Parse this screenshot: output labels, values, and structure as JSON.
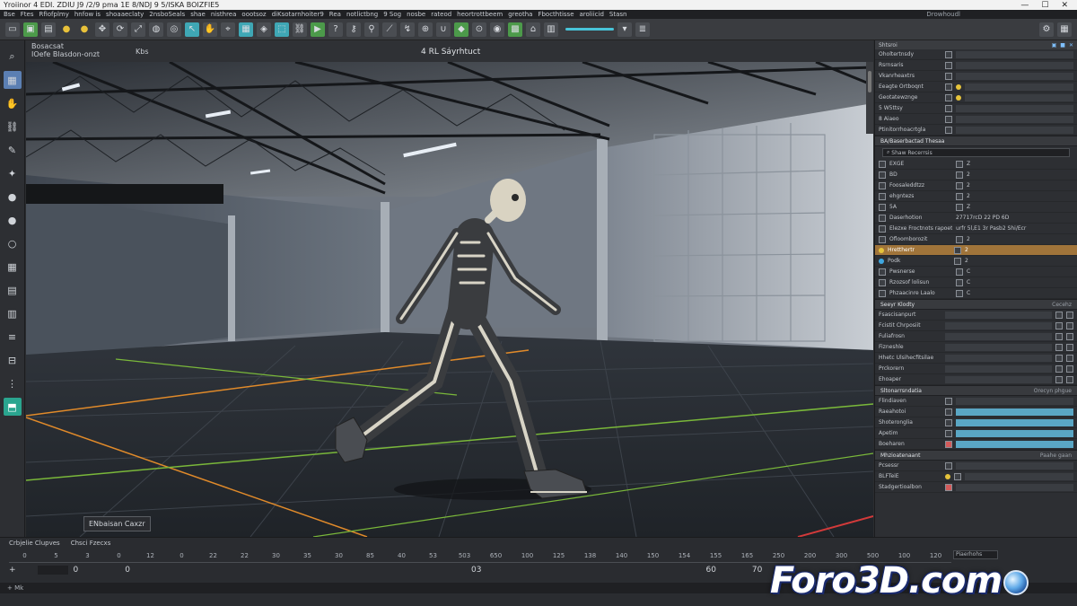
{
  "window": {
    "title": "Yroiinor 4 EDI. ZDIU J9 /2/9 pma 1E 8/NDJ 9 5/ISKA BOIZFIE5",
    "minimize": "—",
    "maximize": "☐",
    "close": "✕"
  },
  "menu": {
    "items": [
      "Bse",
      "Ftes",
      "Rfiofplmy",
      "hnfow is",
      "shoaaeclaty",
      "2nsboSeals",
      "shae",
      "nisthrea",
      "oootsoz",
      "diKsotarnhoiter9",
      "Rea",
      "notlictbng",
      "9 Sog",
      "nosbe",
      "rateod",
      "heortrottbeem",
      "greotha",
      "Fbocthtisse",
      "aroliicid",
      "Stasn"
    ],
    "right_label": "Drowhoudl"
  },
  "toolbar": {
    "right_icons": [
      "gear-icon",
      "grid-icon"
    ]
  },
  "viewport": {
    "panel_title": "Bosacsat",
    "panel_subtitle": "IOefe Blasdon-onzt",
    "mode_label": "Kbs",
    "camera_label": "4 RL Sáyrhtuct",
    "tag_label": "ENbaisan Caxzr"
  },
  "right_panel": {
    "header": "Shtsroi",
    "top_rows": [
      {
        "name": "Oholtertnsdy"
      },
      {
        "name": "Rsrnsaris"
      },
      {
        "name": "Vkanrheaxtrs"
      },
      {
        "name": "Eeagte Ortboqnt"
      },
      {
        "name": "Geotatewznge"
      },
      {
        "name": "5 W5ttsy"
      },
      {
        "name": "8 Aiaeo"
      },
      {
        "name": "Ptinitorrhoacrtgla"
      }
    ],
    "section1": "BA/Baserbactad Thesaa",
    "search": "Shaw Recerrsis",
    "list_rows": [
      {
        "name": "EXGE",
        "val": "Z"
      },
      {
        "name": "BD",
        "val": "2"
      },
      {
        "name": "Foosaleddtzz",
        "val": "2"
      },
      {
        "name": "ehgntezs",
        "val": "2"
      },
      {
        "name": "5A",
        "val": "Z"
      },
      {
        "name": "Daserhotion",
        "val": "27717rcD 22 PD 6D"
      },
      {
        "name": "Elezxe Froctnots rapoetg",
        "val": "urfr 5l,E1 3r Pasb2 Shi/Ecr"
      },
      {
        "name": "Ofloomborozit",
        "val": "2"
      },
      {
        "name": "Hretthertr",
        "val": "2"
      },
      {
        "name": "Podk",
        "val": "2"
      },
      {
        "name": "Pwsnerse",
        "val": "C"
      },
      {
        "name": "Rzozsof lolisun",
        "val": "C"
      },
      {
        "name": "Phzaacinre Laalo",
        "val": "C"
      }
    ],
    "section2": "Seeyr Klodty",
    "section2_right": "Cecehz",
    "bone_rows": [
      {
        "name": "Fsascisanpurt"
      },
      {
        "name": "Fcistit Chrposiit"
      },
      {
        "name": "Fuliafrosn"
      },
      {
        "name": "Fizneshle"
      },
      {
        "name": "Hhetc Ulsihecfitsilae"
      },
      {
        "name": "Prckorern"
      },
      {
        "name": "Ehoaper"
      }
    ],
    "section3": "Sltonarrsndatia",
    "section3_right": "Orecyn phgue",
    "anim_rows": [
      {
        "name": "Flindiaven"
      },
      {
        "name": "Raeahotoi"
      },
      {
        "name": "Shoteronglia"
      },
      {
        "name": "Apetim"
      },
      {
        "name": "Boeharen"
      }
    ],
    "section4": "Mhzioatenaant",
    "section4_right": "Paahe gaan",
    "bottom_rows": [
      {
        "name": "Pcsessr"
      },
      {
        "name": "BLFTeiE"
      },
      {
        "name": "Stadgertioalbon"
      }
    ]
  },
  "timeline": {
    "tabs": [
      "Crbjelie Clupves",
      "Chsci Fzecxs"
    ],
    "ticks": [
      "0",
      "5",
      "3",
      "0",
      "12",
      "0",
      "22",
      "22",
      "30",
      "35",
      "30",
      "85",
      "40",
      "53",
      "503",
      "650",
      "100",
      "125",
      "138",
      "140",
      "150",
      "154",
      "155",
      "165",
      "250",
      "200",
      "300",
      "500",
      "100",
      "120"
    ],
    "track_ticks": [
      "0",
      "0",
      "03",
      "60",
      "70",
      "0"
    ],
    "bottom_label": "+ Mk",
    "right_field": "Piaerhohs"
  },
  "watermark": {
    "text": "Foro3D.com"
  },
  "colors": {
    "accent_teal": "#3fa7b5",
    "selection_orange": "#a0743a",
    "grid_green": "#7ab83a",
    "grid_orange": "#e08a2a",
    "grid_red": "#d33a3a"
  }
}
